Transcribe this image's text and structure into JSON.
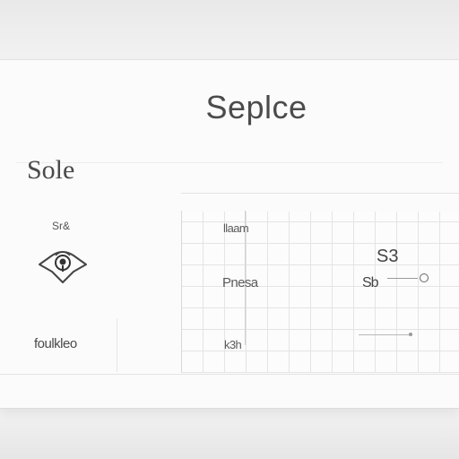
{
  "header": {
    "title": "Seplce"
  },
  "sidebar": {
    "title": "Sole",
    "small_label": "Sr&",
    "pin_icon": "map-pin-icon",
    "bottom_label": "foulkleo"
  },
  "grid": {
    "rows": [
      {
        "label": "llaam"
      },
      {
        "label": "Pnesa"
      },
      {
        "label": "k3h"
      }
    ],
    "value_top": "S3",
    "value_mid": "Sb"
  },
  "colors": {
    "card": "#fbfbfb",
    "text": "#4b4b4b",
    "grid_line": "#e4e4e4"
  }
}
